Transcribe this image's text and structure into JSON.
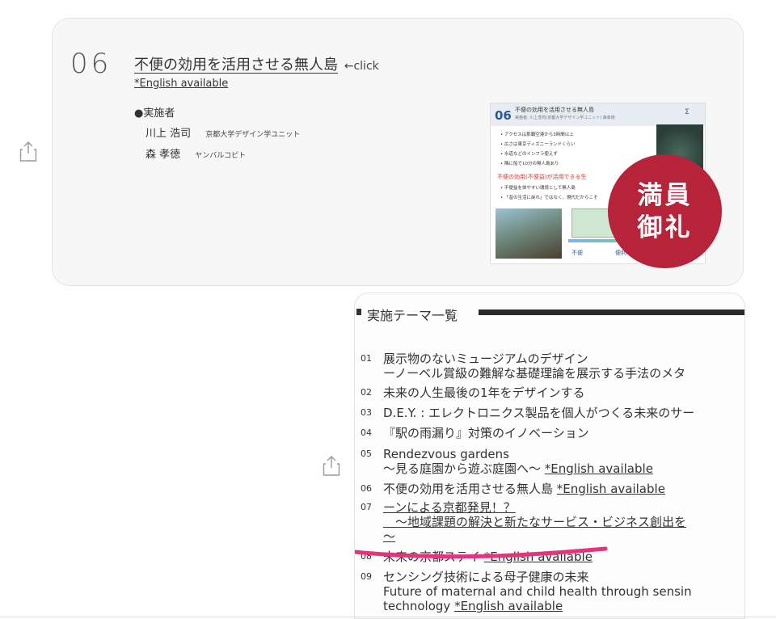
{
  "message1": {
    "number": "06",
    "title": "不便の効用を活用させる無人島",
    "click_hint": "←click",
    "english_available": "*English available",
    "implementer_label": "●実施者",
    "people": [
      {
        "name": "川上 浩司",
        "affiliation": "京都大学デザイン学ユニット"
      },
      {
        "name": "森 孝徳",
        "affiliation": "ヤンバルコピト"
      }
    ],
    "slide": {
      "number": "06",
      "title": "不便の効用を活用させる無人島",
      "subtitle": "実施者: 川上浩司(京都大学デザイン学ユニット) 森孝徳",
      "bullets": [
        "• アクセスは那覇空港から3時間以上",
        "• 広さは東京ディズニーランドくらい",
        "• 水道などのインフラ使えず",
        "• 隣に船で10分の無人島あり"
      ],
      "red_text": "不便の効用(不便益)が活用できる生",
      "bullets2": [
        "• 不便益を体やすい環境として無人島",
        "• 「昔の生活に戻れ」ではなく、現代だからこそ"
      ],
      "fuben": "不便",
      "benri": "便利"
    },
    "stamp_lines": [
      "満員",
      "御礼"
    ]
  },
  "message2": {
    "section_title": "実施テーマ一覧",
    "themes": [
      {
        "num": "01",
        "lines": [
          "展示物のないミュージアムのデザイン",
          "ーノーベル賞級の難解な基礎理論を展示する手法のメタ"
        ]
      },
      {
        "num": "02",
        "lines": [
          "未来の人生最後の1年をデザインする"
        ]
      },
      {
        "num": "03",
        "lines": [
          "D.E.Y. : エレクトロニクス製品を個人がつくる未来のサー"
        ]
      },
      {
        "num": "04",
        "lines": [
          "『駅の雨漏り』対策のイノベーション"
        ]
      },
      {
        "num": "05",
        "lines": [
          "Rendezvous gardens",
          "～見る庭園から遊ぶ庭園へ～ "
        ],
        "english": "*English available"
      },
      {
        "num": "06",
        "lines": [
          "不便の効用を活用させる無人島 "
        ],
        "english": "*English available"
      },
      {
        "num": "07",
        "lines": [
          "ーンによる京都発見！？",
          "　～地域課題の解決と新たなサービス・ビジネス創出を",
          "～"
        ]
      },
      {
        "num": "08",
        "lines": [
          "未来の京都ステイ "
        ],
        "english": "*English available"
      },
      {
        "num": "09",
        "lines": [
          "センシング技術による母子健康の未来",
          "Future of maternal and child health through sensin",
          "technology "
        ],
        "english": "*English available"
      }
    ]
  },
  "icons": {
    "share": "share-icon"
  },
  "colors": {
    "stamp": "#b7243a",
    "highlight_stroke": "#e8327a"
  }
}
